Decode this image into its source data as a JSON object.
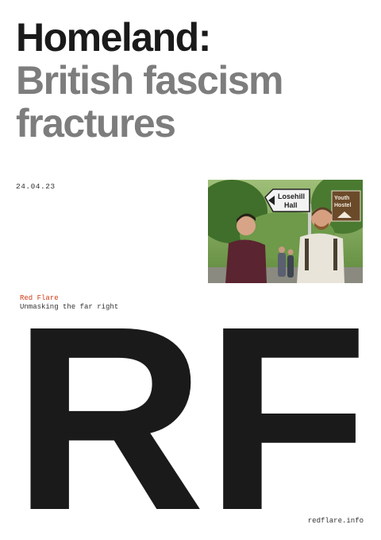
{
  "headline": {
    "line1": "Homeland:",
    "line2": "British fascism",
    "line3": "fractures"
  },
  "date": "24.04.23",
  "photo": {
    "sign_main_line1": "Losehill",
    "sign_main_line2": "Hall",
    "sign_secondary_line1": "Youth",
    "sign_secondary_line2": "Hostel"
  },
  "brand": {
    "name": "Red Flare",
    "tagline": "Unmasking the far right",
    "logo_text": "RF"
  },
  "footer": {
    "url": "redflare.info"
  },
  "colors": {
    "headline_dark": "#1a1a1a",
    "headline_grey": "#7d7d7d",
    "brand_red": "#d23a12",
    "logo_black": "#1a1a1a"
  }
}
